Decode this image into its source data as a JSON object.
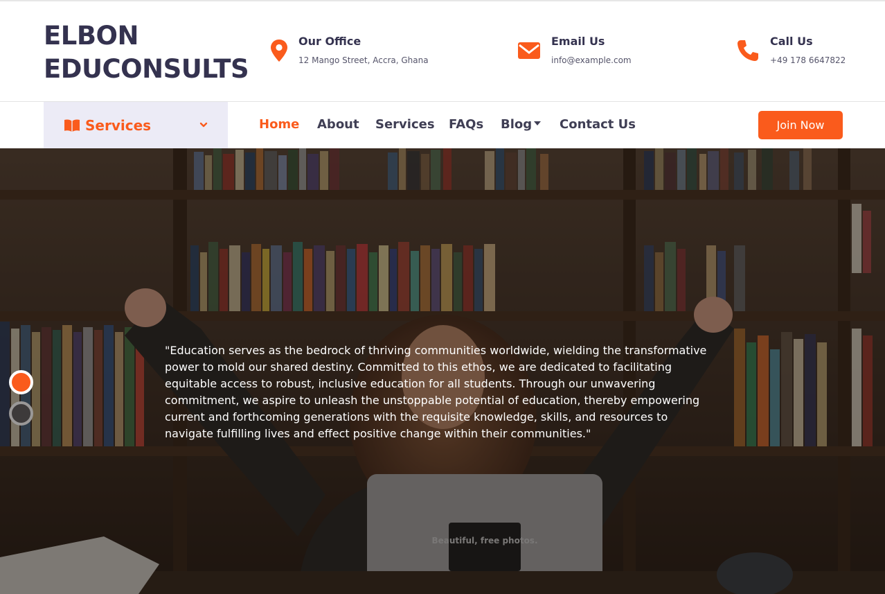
{
  "brand": {
    "line1": "ELBON",
    "line2": "EDUCONSULTS"
  },
  "contacts": [
    {
      "title": "Our Office",
      "value": "12 Mango Street, Accra, Ghana",
      "icon": "map-marker-icon"
    },
    {
      "title": "Email Us",
      "value": "info@example.com",
      "icon": "envelope-icon"
    },
    {
      "title": "Call Us",
      "value": "+49 178 6647822",
      "icon": "phone-icon"
    }
  ],
  "services_dropdown": {
    "label": "Services",
    "icon": "book-icon"
  },
  "nav": {
    "items": [
      {
        "label": "Home",
        "active": true
      },
      {
        "label": "About"
      },
      {
        "label": "Services"
      },
      {
        "label": "FAQs"
      },
      {
        "label": "Blog"
      },
      {
        "label": "Contact Us"
      }
    ]
  },
  "join_button": "Join Now",
  "hero": {
    "quote": "\"Education serves as the bedrock of thriving communities worldwide, wielding the transformative power to mold our shared destiny. Committed to this ethos, we are dedicated to facilitating equitable access to robust, inclusive education for all students. Through our unwavering commitment, we aspire to unleash the unstoppable potential of education, thereby empowering current and forthcoming generations with the requisite knowledge, skills, and resources to navigate fulfilling lives and effect positive change within their communities.\"",
    "slides": 2,
    "active_slide": 1,
    "laptop_sticker": "Beautiful, free photos."
  },
  "colors": {
    "accent": "#fa5b1c",
    "heading": "#34324f",
    "dropdown_bg": "#ecebf6"
  }
}
